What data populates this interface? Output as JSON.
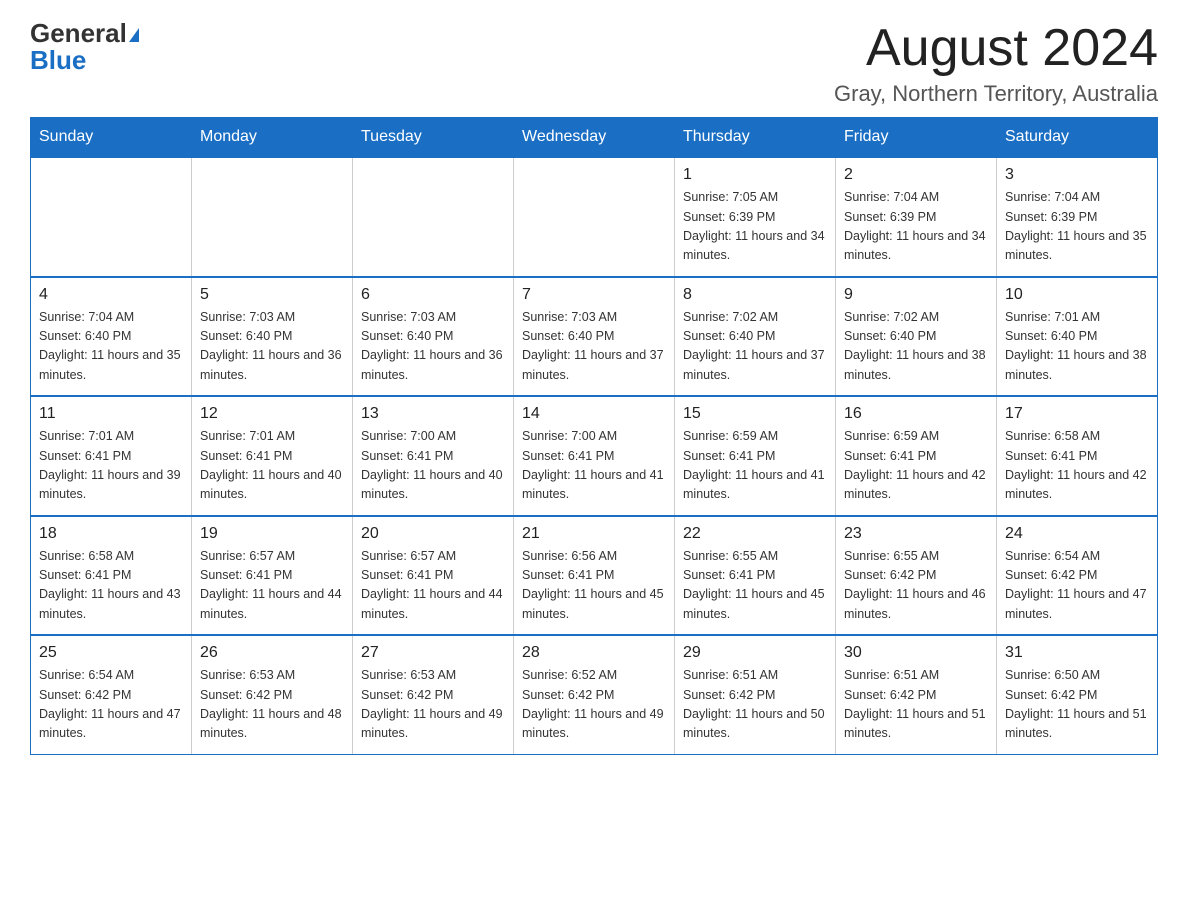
{
  "header": {
    "logo_general": "General",
    "logo_blue": "Blue",
    "month_title": "August 2024",
    "location": "Gray, Northern Territory, Australia"
  },
  "days_of_week": [
    "Sunday",
    "Monday",
    "Tuesday",
    "Wednesday",
    "Thursday",
    "Friday",
    "Saturday"
  ],
  "weeks": [
    [
      {
        "day": "",
        "info": ""
      },
      {
        "day": "",
        "info": ""
      },
      {
        "day": "",
        "info": ""
      },
      {
        "day": "",
        "info": ""
      },
      {
        "day": "1",
        "info": "Sunrise: 7:05 AM\nSunset: 6:39 PM\nDaylight: 11 hours and 34 minutes."
      },
      {
        "day": "2",
        "info": "Sunrise: 7:04 AM\nSunset: 6:39 PM\nDaylight: 11 hours and 34 minutes."
      },
      {
        "day": "3",
        "info": "Sunrise: 7:04 AM\nSunset: 6:39 PM\nDaylight: 11 hours and 35 minutes."
      }
    ],
    [
      {
        "day": "4",
        "info": "Sunrise: 7:04 AM\nSunset: 6:40 PM\nDaylight: 11 hours and 35 minutes."
      },
      {
        "day": "5",
        "info": "Sunrise: 7:03 AM\nSunset: 6:40 PM\nDaylight: 11 hours and 36 minutes."
      },
      {
        "day": "6",
        "info": "Sunrise: 7:03 AM\nSunset: 6:40 PM\nDaylight: 11 hours and 36 minutes."
      },
      {
        "day": "7",
        "info": "Sunrise: 7:03 AM\nSunset: 6:40 PM\nDaylight: 11 hours and 37 minutes."
      },
      {
        "day": "8",
        "info": "Sunrise: 7:02 AM\nSunset: 6:40 PM\nDaylight: 11 hours and 37 minutes."
      },
      {
        "day": "9",
        "info": "Sunrise: 7:02 AM\nSunset: 6:40 PM\nDaylight: 11 hours and 38 minutes."
      },
      {
        "day": "10",
        "info": "Sunrise: 7:01 AM\nSunset: 6:40 PM\nDaylight: 11 hours and 38 minutes."
      }
    ],
    [
      {
        "day": "11",
        "info": "Sunrise: 7:01 AM\nSunset: 6:41 PM\nDaylight: 11 hours and 39 minutes."
      },
      {
        "day": "12",
        "info": "Sunrise: 7:01 AM\nSunset: 6:41 PM\nDaylight: 11 hours and 40 minutes."
      },
      {
        "day": "13",
        "info": "Sunrise: 7:00 AM\nSunset: 6:41 PM\nDaylight: 11 hours and 40 minutes."
      },
      {
        "day": "14",
        "info": "Sunrise: 7:00 AM\nSunset: 6:41 PM\nDaylight: 11 hours and 41 minutes."
      },
      {
        "day": "15",
        "info": "Sunrise: 6:59 AM\nSunset: 6:41 PM\nDaylight: 11 hours and 41 minutes."
      },
      {
        "day": "16",
        "info": "Sunrise: 6:59 AM\nSunset: 6:41 PM\nDaylight: 11 hours and 42 minutes."
      },
      {
        "day": "17",
        "info": "Sunrise: 6:58 AM\nSunset: 6:41 PM\nDaylight: 11 hours and 42 minutes."
      }
    ],
    [
      {
        "day": "18",
        "info": "Sunrise: 6:58 AM\nSunset: 6:41 PM\nDaylight: 11 hours and 43 minutes."
      },
      {
        "day": "19",
        "info": "Sunrise: 6:57 AM\nSunset: 6:41 PM\nDaylight: 11 hours and 44 minutes."
      },
      {
        "day": "20",
        "info": "Sunrise: 6:57 AM\nSunset: 6:41 PM\nDaylight: 11 hours and 44 minutes."
      },
      {
        "day": "21",
        "info": "Sunrise: 6:56 AM\nSunset: 6:41 PM\nDaylight: 11 hours and 45 minutes."
      },
      {
        "day": "22",
        "info": "Sunrise: 6:55 AM\nSunset: 6:41 PM\nDaylight: 11 hours and 45 minutes."
      },
      {
        "day": "23",
        "info": "Sunrise: 6:55 AM\nSunset: 6:42 PM\nDaylight: 11 hours and 46 minutes."
      },
      {
        "day": "24",
        "info": "Sunrise: 6:54 AM\nSunset: 6:42 PM\nDaylight: 11 hours and 47 minutes."
      }
    ],
    [
      {
        "day": "25",
        "info": "Sunrise: 6:54 AM\nSunset: 6:42 PM\nDaylight: 11 hours and 47 minutes."
      },
      {
        "day": "26",
        "info": "Sunrise: 6:53 AM\nSunset: 6:42 PM\nDaylight: 11 hours and 48 minutes."
      },
      {
        "day": "27",
        "info": "Sunrise: 6:53 AM\nSunset: 6:42 PM\nDaylight: 11 hours and 49 minutes."
      },
      {
        "day": "28",
        "info": "Sunrise: 6:52 AM\nSunset: 6:42 PM\nDaylight: 11 hours and 49 minutes."
      },
      {
        "day": "29",
        "info": "Sunrise: 6:51 AM\nSunset: 6:42 PM\nDaylight: 11 hours and 50 minutes."
      },
      {
        "day": "30",
        "info": "Sunrise: 6:51 AM\nSunset: 6:42 PM\nDaylight: 11 hours and 51 minutes."
      },
      {
        "day": "31",
        "info": "Sunrise: 6:50 AM\nSunset: 6:42 PM\nDaylight: 11 hours and 51 minutes."
      }
    ]
  ]
}
